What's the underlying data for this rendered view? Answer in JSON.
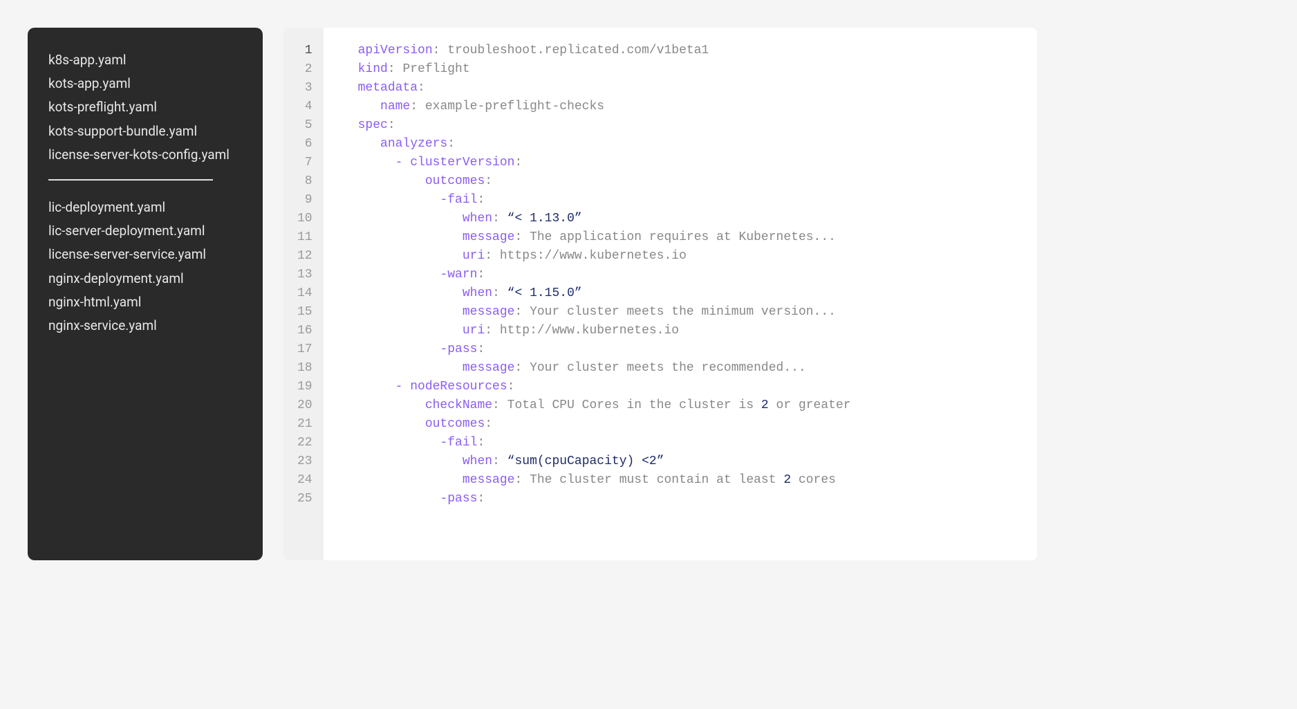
{
  "sidebar": {
    "group1": [
      "k8s-app.yaml",
      "kots-app.yaml",
      "kots-preflight.yaml",
      "kots-support-bundle.yaml",
      "license-server-kots-config.yaml"
    ],
    "group2": [
      "lic-deployment.yaml",
      "lic-server-deployment.yaml",
      "license-server-service.yaml",
      "nginx-deployment.yaml",
      "nginx-html.yaml",
      "nginx-service.yaml"
    ]
  },
  "editor": {
    "current_line": 1,
    "line_count": 25,
    "lines": [
      [
        {
          "t": "key",
          "v": "apiVersion"
        },
        {
          "t": "punct",
          "v": ": "
        },
        {
          "t": "val",
          "v": "troubleshoot.replicated.com/v1beta1"
        }
      ],
      [
        {
          "t": "key",
          "v": "kind"
        },
        {
          "t": "punct",
          "v": ": "
        },
        {
          "t": "val",
          "v": "Preflight"
        }
      ],
      [
        {
          "t": "key",
          "v": "metadata"
        },
        {
          "t": "punct",
          "v": ":"
        }
      ],
      [
        {
          "t": "indent",
          "v": "   "
        },
        {
          "t": "key",
          "v": "name"
        },
        {
          "t": "punct",
          "v": ": "
        },
        {
          "t": "val",
          "v": "example-preflight-checks"
        }
      ],
      [
        {
          "t": "key",
          "v": "spec"
        },
        {
          "t": "punct",
          "v": ":"
        }
      ],
      [
        {
          "t": "indent",
          "v": "   "
        },
        {
          "t": "key",
          "v": "analyzers"
        },
        {
          "t": "punct",
          "v": ":"
        }
      ],
      [
        {
          "t": "indent",
          "v": "     "
        },
        {
          "t": "key",
          "v": "- clusterVersion"
        },
        {
          "t": "punct",
          "v": ":"
        }
      ],
      [
        {
          "t": "indent",
          "v": "         "
        },
        {
          "t": "key",
          "v": "outcomes"
        },
        {
          "t": "punct",
          "v": ":"
        }
      ],
      [
        {
          "t": "indent",
          "v": "           "
        },
        {
          "t": "key",
          "v": "-fail"
        },
        {
          "t": "punct",
          "v": ":"
        }
      ],
      [
        {
          "t": "indent",
          "v": "              "
        },
        {
          "t": "key",
          "v": "when"
        },
        {
          "t": "punct",
          "v": ": "
        },
        {
          "t": "str",
          "v": "“< 1.13.0”"
        }
      ],
      [
        {
          "t": "indent",
          "v": "              "
        },
        {
          "t": "key",
          "v": "message"
        },
        {
          "t": "punct",
          "v": ": "
        },
        {
          "t": "val",
          "v": "The application requires at Kubernetes..."
        }
      ],
      [
        {
          "t": "indent",
          "v": "              "
        },
        {
          "t": "key",
          "v": "uri"
        },
        {
          "t": "punct",
          "v": ": "
        },
        {
          "t": "val",
          "v": "https://www.kubernetes.io"
        }
      ],
      [
        {
          "t": "indent",
          "v": "           "
        },
        {
          "t": "key",
          "v": "-warn"
        },
        {
          "t": "punct",
          "v": ":"
        }
      ],
      [
        {
          "t": "indent",
          "v": "              "
        },
        {
          "t": "key",
          "v": "when"
        },
        {
          "t": "punct",
          "v": ": "
        },
        {
          "t": "str",
          "v": "“< 1.15.0”"
        }
      ],
      [
        {
          "t": "indent",
          "v": "              "
        },
        {
          "t": "key",
          "v": "message"
        },
        {
          "t": "punct",
          "v": ": "
        },
        {
          "t": "val",
          "v": "Your cluster meets the minimum version..."
        }
      ],
      [
        {
          "t": "indent",
          "v": "              "
        },
        {
          "t": "key",
          "v": "uri"
        },
        {
          "t": "punct",
          "v": ": "
        },
        {
          "t": "val",
          "v": "http://www.kubernetes.io"
        }
      ],
      [
        {
          "t": "indent",
          "v": "           "
        },
        {
          "t": "key",
          "v": "-pass"
        },
        {
          "t": "punct",
          "v": ":"
        }
      ],
      [
        {
          "t": "indent",
          "v": "              "
        },
        {
          "t": "key",
          "v": "message"
        },
        {
          "t": "punct",
          "v": ": "
        },
        {
          "t": "val",
          "v": "Your cluster meets the recommended..."
        }
      ],
      [
        {
          "t": "indent",
          "v": "     "
        },
        {
          "t": "key",
          "v": "- nodeResources"
        },
        {
          "t": "punct",
          "v": ":"
        }
      ],
      [
        {
          "t": "indent",
          "v": "         "
        },
        {
          "t": "key",
          "v": "checkName"
        },
        {
          "t": "punct",
          "v": ": "
        },
        {
          "t": "val",
          "v": "Total CPU Cores in the cluster is "
        },
        {
          "t": "num",
          "v": "2"
        },
        {
          "t": "val",
          "v": " or greater"
        }
      ],
      [
        {
          "t": "indent",
          "v": "         "
        },
        {
          "t": "key",
          "v": "outcomes"
        },
        {
          "t": "punct",
          "v": ":"
        }
      ],
      [
        {
          "t": "indent",
          "v": "           "
        },
        {
          "t": "key",
          "v": "-fail"
        },
        {
          "t": "punct",
          "v": ":"
        }
      ],
      [
        {
          "t": "indent",
          "v": "              "
        },
        {
          "t": "key",
          "v": "when"
        },
        {
          "t": "punct",
          "v": ": "
        },
        {
          "t": "str",
          "v": "“sum(cpuCapacity) <2”"
        }
      ],
      [
        {
          "t": "indent",
          "v": "              "
        },
        {
          "t": "key",
          "v": "message"
        },
        {
          "t": "punct",
          "v": ": "
        },
        {
          "t": "val",
          "v": "The cluster must contain at least "
        },
        {
          "t": "num",
          "v": "2"
        },
        {
          "t": "val",
          "v": " cores"
        }
      ],
      [
        {
          "t": "indent",
          "v": "           "
        },
        {
          "t": "key",
          "v": "-pass"
        },
        {
          "t": "punct",
          "v": ":"
        }
      ]
    ]
  }
}
